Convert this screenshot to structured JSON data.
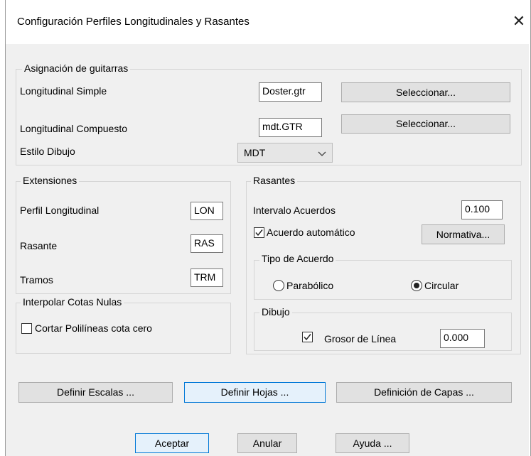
{
  "window": {
    "title": "Configuración Perfiles Longitudinales y Rasantes",
    "close_glyph": "✕"
  },
  "asignacion": {
    "title": "Asignación de guitarras",
    "long_simple_label": "Longitudinal Simple",
    "long_simple_value": "Doster.gtr",
    "long_compuesto_label": "Longitudinal Compuesto",
    "long_compuesto_value": "mdt.GTR",
    "seleccionar_label": "Seleccionar...",
    "estilo_label": "Estilo Dibujo",
    "estilo_value": "MDT"
  },
  "extensiones": {
    "title": "Extensiones",
    "perfil_label": "Perfil Longitudinal",
    "perfil_value": "LON",
    "rasante_label": "Rasante",
    "rasante_value": "RAS",
    "tramos_label": "Tramos",
    "tramos_value": "TRM"
  },
  "interpolar": {
    "title": "Interpolar Cotas Nulas",
    "cortar_label": "Cortar Polilíneas cota cero",
    "cortar_checked": false
  },
  "rasantes": {
    "title": "Rasantes",
    "intervalo_label": "Intervalo Acuerdos",
    "intervalo_value": "0.100",
    "acuerdo_auto_label": "Acuerdo automático",
    "acuerdo_auto_checked": true,
    "normativa_label": "Normativa...",
    "tipo": {
      "title": "Tipo de Acuerdo",
      "parabolico_label": "Parabólico",
      "circular_label": "Circular",
      "selected": "Circular"
    },
    "dibujo": {
      "title": "Dibujo",
      "grosor_label": "Grosor de Línea",
      "grosor_value": "0.000",
      "grosor_checked": true
    }
  },
  "buttons": {
    "escalas": "Definir Escalas ...",
    "hojas": "Definir Hojas ...",
    "capas": "Definición de Capas ...",
    "aceptar": "Aceptar",
    "anular": "Anular",
    "ayuda": "Ayuda ..."
  }
}
